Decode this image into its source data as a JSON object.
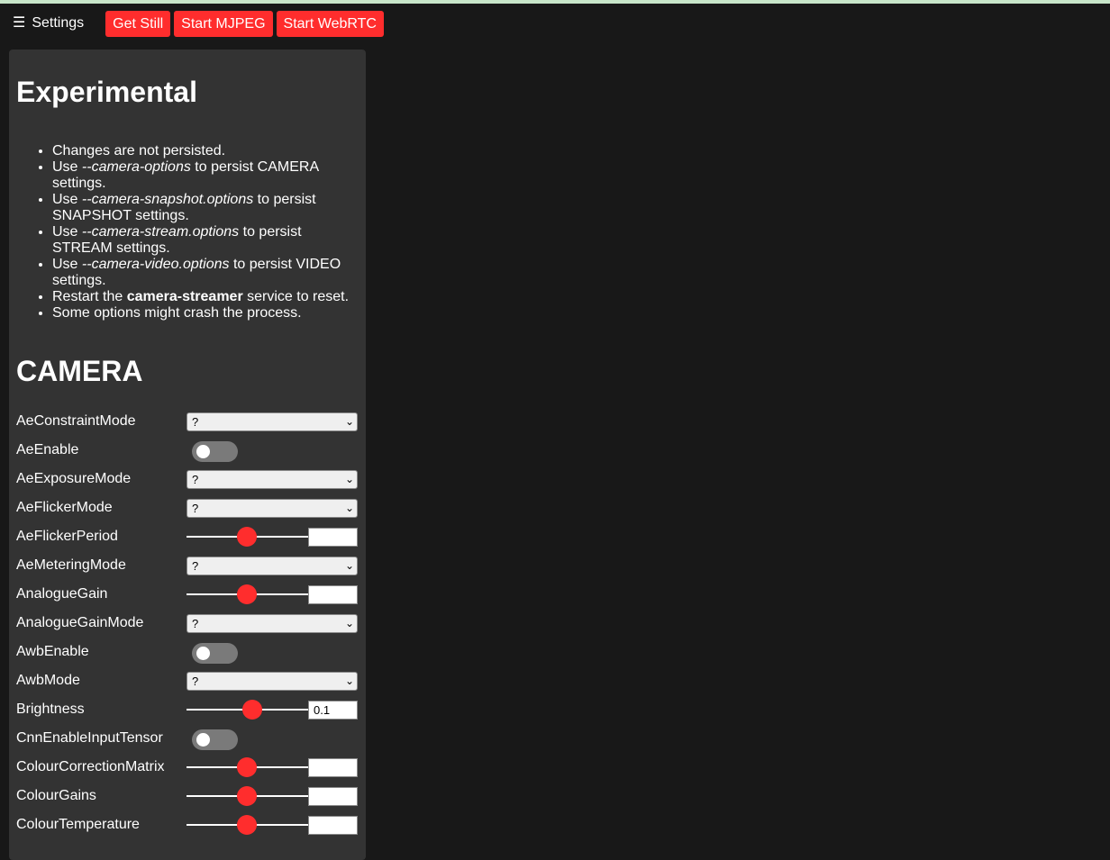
{
  "toolbar": {
    "settings_label": "Settings",
    "buttons": [
      "Get Still",
      "Start MJPEG",
      "Start WebRTC"
    ]
  },
  "panel": {
    "heading1": "Experimental",
    "notes": {
      "n1": "Changes are not persisted.",
      "use": "Use ",
      "persist": " to persist ",
      "opt_camera": "--camera-options",
      "cat_camera": "CAMERA settings.",
      "opt_snapshot": "--camera-snapshot.options",
      "cat_snapshot": "SNAPSHOT settings.",
      "opt_stream": "--camera-stream.options",
      "cat_stream": "STREAM settings.",
      "opt_video": "--camera-video.options",
      "cat_video": "VIDEO settings.",
      "restart_pre": "Restart the ",
      "restart_service": "camera-streamer",
      "restart_post": " service to reset.",
      "n_last": "Some options might crash the process."
    },
    "heading2": "CAMERA"
  },
  "controls": [
    {
      "label": "AeConstraintMode",
      "type": "select",
      "value": "?"
    },
    {
      "label": "AeEnable",
      "type": "toggle",
      "on": false
    },
    {
      "label": "AeExposureMode",
      "type": "select",
      "value": "?"
    },
    {
      "label": "AeFlickerMode",
      "type": "select",
      "value": "?"
    },
    {
      "label": "AeFlickerPeriod",
      "type": "slider",
      "position": 0.49,
      "value": ""
    },
    {
      "label": "AeMeteringMode",
      "type": "select",
      "value": "?"
    },
    {
      "label": "AnalogueGain",
      "type": "slider",
      "position": 0.49,
      "value": ""
    },
    {
      "label": "AnalogueGainMode",
      "type": "select",
      "value": "?"
    },
    {
      "label": "AwbEnable",
      "type": "toggle",
      "on": false
    },
    {
      "label": "AwbMode",
      "type": "select",
      "value": "?"
    },
    {
      "label": "Brightness",
      "type": "slider",
      "position": 0.535,
      "value": "0.1"
    },
    {
      "label": "CnnEnableInputTensor",
      "type": "toggle",
      "on": false
    },
    {
      "label": "ColourCorrectionMatrix",
      "type": "slider",
      "position": 0.49,
      "value": ""
    },
    {
      "label": "ColourGains",
      "type": "slider",
      "position": 0.49,
      "value": ""
    },
    {
      "label": "ColourTemperature",
      "type": "slider",
      "position": 0.49,
      "value": ""
    }
  ],
  "colors": {
    "accent": "#ff2d2d",
    "panel_bg": "#333333",
    "page_bg": "#181818"
  },
  "icons": {
    "menu": "hamburger-icon",
    "select": "chevron-down-icon"
  }
}
